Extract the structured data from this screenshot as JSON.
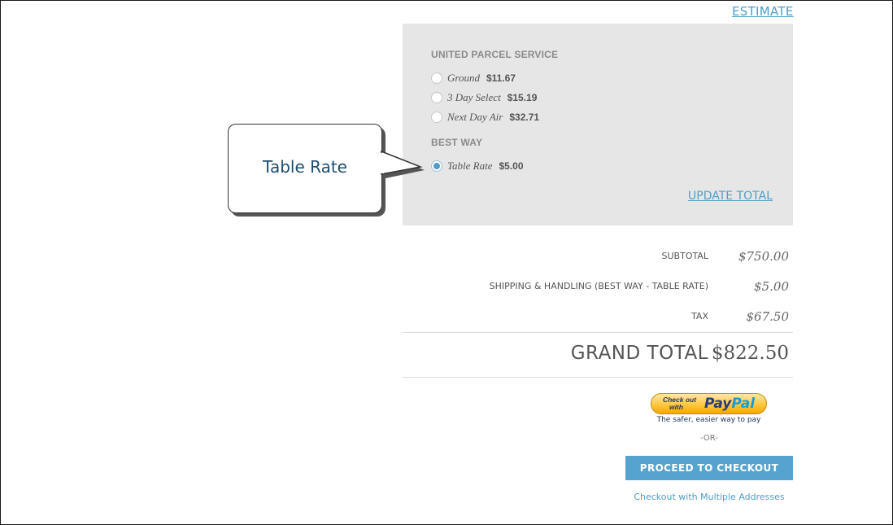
{
  "estimate_link": "ESTIMATE",
  "shipping": {
    "groups": [
      {
        "title": "UNITED PARCEL SERVICE",
        "options": [
          {
            "name": "Ground",
            "price": "$11.67",
            "selected": false
          },
          {
            "name": "3 Day Select",
            "price": "$15.19",
            "selected": false
          },
          {
            "name": "Next Day Air",
            "price": "$32.71",
            "selected": false
          }
        ]
      },
      {
        "title": "BEST WAY",
        "options": [
          {
            "name": "Table Rate",
            "price": "$5.00",
            "selected": true
          }
        ]
      }
    ],
    "update_total": "UPDATE TOTAL"
  },
  "callout": {
    "text": "Table Rate"
  },
  "totals": {
    "subtotal_label": "SUBTOTAL",
    "subtotal_value": "$750.00",
    "shipping_label": "SHIPPING & HANDLING (BEST WAY - TABLE RATE)",
    "shipping_value": "$5.00",
    "tax_label": "TAX",
    "tax_value": "$67.50",
    "grand_label": "GRAND TOTAL",
    "grand_value": "$822.50"
  },
  "paypal": {
    "check_out_line1": "Check out",
    "check_out_line2": "with",
    "logo_pay": "Pay",
    "logo_pal": "Pal",
    "tagline": "The safer, easier way to pay"
  },
  "or_text": "-OR-",
  "checkout_button": "PROCEED TO CHECKOUT",
  "multi_address_link": "Checkout with Multiple Addresses"
}
